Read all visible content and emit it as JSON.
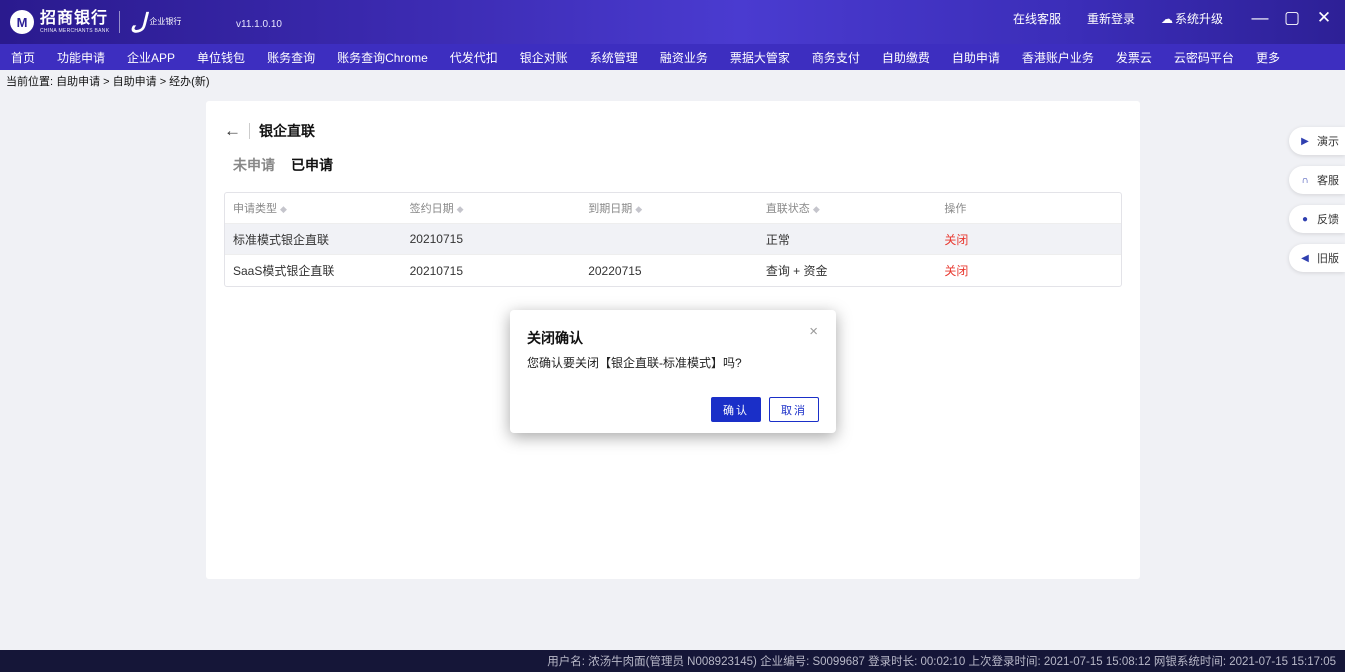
{
  "titlebar": {
    "bank_name": "招商银行",
    "bank_name_en": "CHINA MERCHANTS BANK",
    "corp_bank_label": "企业银行",
    "version": "v11.1.0.10",
    "links": [
      "在线客服",
      "重新登录",
      "系统升级"
    ],
    "minimize_glyph": "—",
    "maximize_glyph": "▢",
    "close_glyph": "✕"
  },
  "menu": [
    "首页",
    "功能申请",
    "企业APP",
    "单位钱包",
    "账务查询",
    "账务查询Chrome",
    "代发代扣",
    "银企对账",
    "系统管理",
    "融资业务",
    "票据大管家",
    "商务支付",
    "自助缴费",
    "自助申请",
    "香港账户业务",
    "发票云",
    "云密码平台",
    "更多"
  ],
  "breadcrumb": "当前位置: 自助申请 > 自助申请 > 经办(新)",
  "card": {
    "back_glyph": "←",
    "title": "银企直联",
    "tabs": [
      "未申请",
      "已申请"
    ],
    "active_tab": "已申请",
    "table": {
      "columns": [
        "申请类型",
        "签约日期",
        "到期日期",
        "直联状态",
        "操作"
      ],
      "rows": [
        {
          "type": "标准模式银企直联",
          "sign_date": "20210715",
          "expire_date": "",
          "status": "正常",
          "action": "关闭"
        },
        {
          "type": "SaaS模式银企直联",
          "sign_date": "20210715",
          "expire_date": "20220715",
          "status": "查询 + 资金",
          "action": "关闭"
        }
      ]
    }
  },
  "side_tools": [
    {
      "label": "演示",
      "icon": "play-icon"
    },
    {
      "label": "客服",
      "icon": "headset-icon"
    },
    {
      "label": "反馈",
      "icon": "chat-icon"
    },
    {
      "label": "旧版",
      "icon": "reply-icon"
    }
  ],
  "modal": {
    "title": "关闭确认",
    "message": "您确认要关闭【银企直联-标准模式】吗?",
    "confirm_label": "确认",
    "cancel_label": "取消",
    "close_glyph": "×"
  },
  "statusbar": "用户名: 浓汤牛肉面(管理员 N008923145)  企业编号: S0099687  登录时长: 00:02:10  上次登录时间: 2021-07-15 15:08:12  网银系统时间: 2021-07-15 15:17:05",
  "colors": {
    "titlebar": "#3b2ab0",
    "menubar": "#3d2ec0",
    "primary": "#1a2fc8",
    "danger": "#e8382f",
    "statusbar": "#151638"
  }
}
